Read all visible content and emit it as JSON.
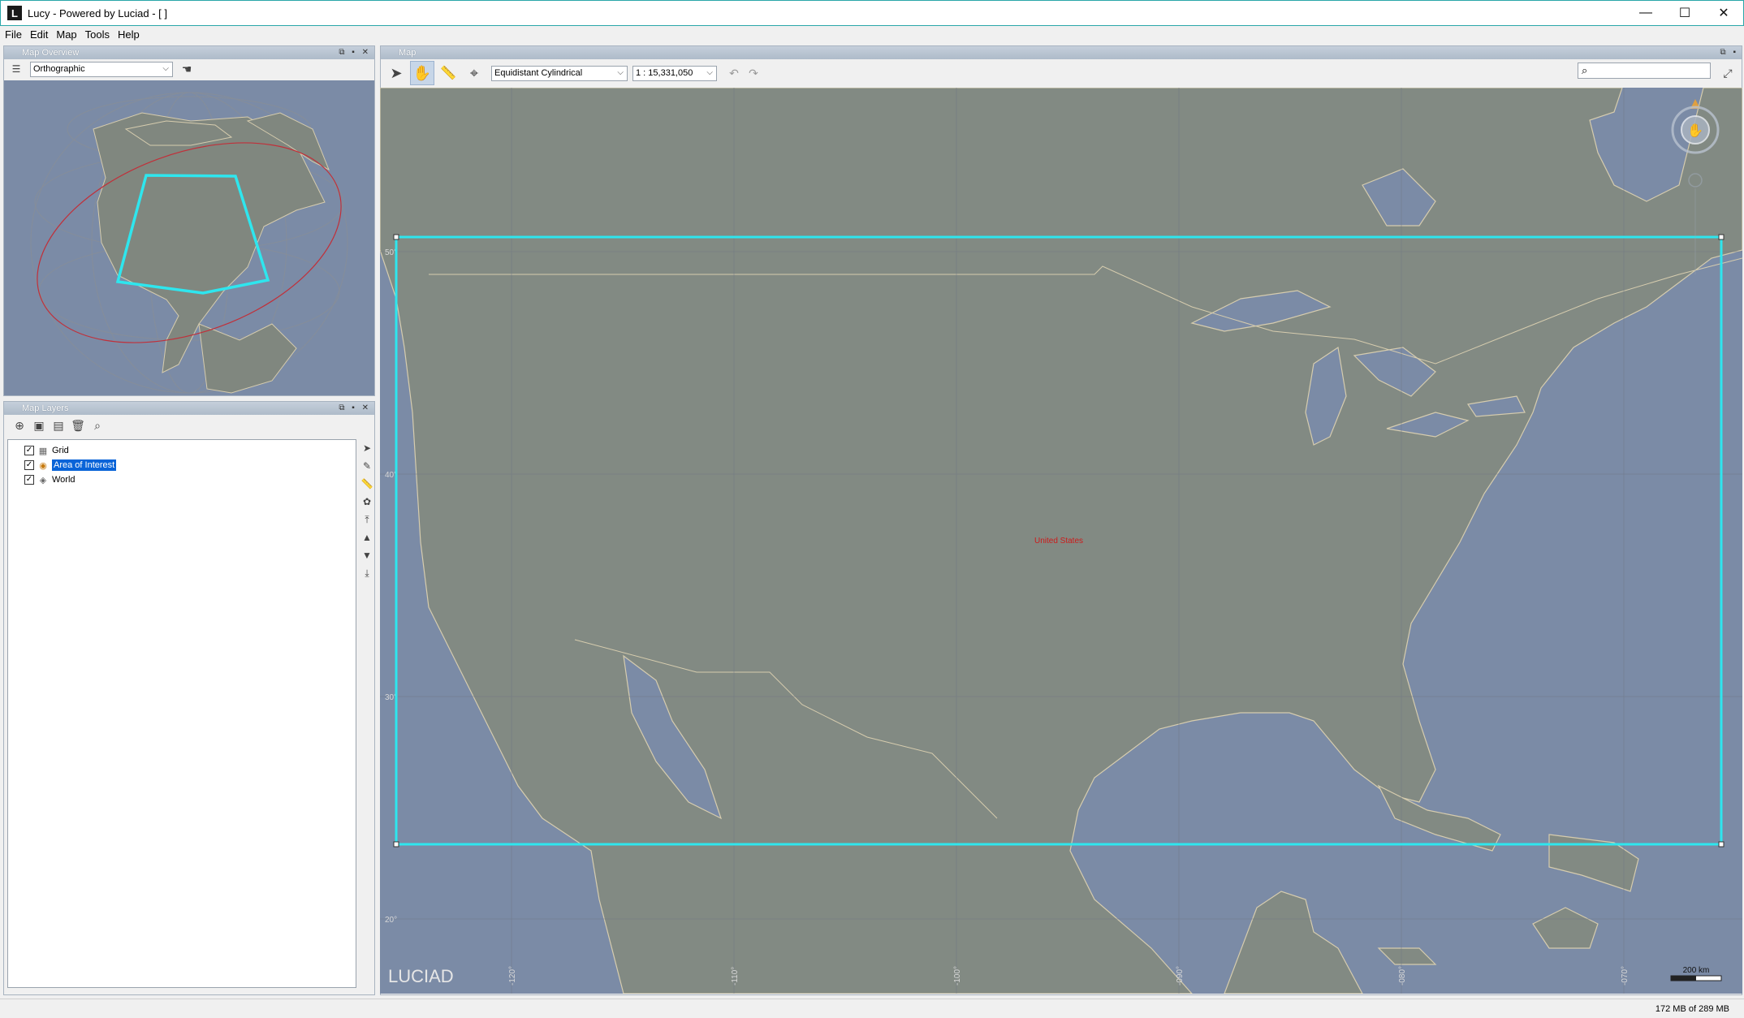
{
  "window": {
    "title": "Lucy - Powered by Luciad - [ ]",
    "app_icon": "L",
    "minimize": "—",
    "maximize": "☐",
    "close": "✕"
  },
  "menu": [
    "File",
    "Edit",
    "Map",
    "Tools",
    "Help"
  ],
  "overview": {
    "title": "Map Overview",
    "projection": "Orthographic"
  },
  "layers_panel": {
    "title": "Map Layers",
    "layers": [
      {
        "label": "Grid",
        "checked": true,
        "icon": "grid-layer-icon"
      },
      {
        "label": "Area of Interest",
        "checked": true,
        "icon": "shape-layer-icon",
        "selected": true
      },
      {
        "label": "World",
        "checked": true,
        "icon": "world-layer-icon"
      }
    ]
  },
  "map": {
    "title": "Map",
    "projection": "Equidistant Cylindrical",
    "scale": "1 : 15,331,050",
    "search_placeholder": "",
    "country_label": "United States",
    "lat_labels": [
      "50°",
      "40°",
      "30°",
      "20°"
    ],
    "lon_labels": [
      "-120°",
      "-110°",
      "-100°",
      "-090°",
      "-080°",
      "-070°"
    ],
    "logo": "LUCIAD",
    "scalebar_label": "200 km",
    "colors": {
      "ocean": "#7b8ba6",
      "land": "#828a83",
      "coast": "#d6ccae",
      "aoi": "#2ee6ee",
      "label": "#cc1b1b"
    }
  },
  "status": {
    "memory": "172 MB of 289 MB"
  }
}
